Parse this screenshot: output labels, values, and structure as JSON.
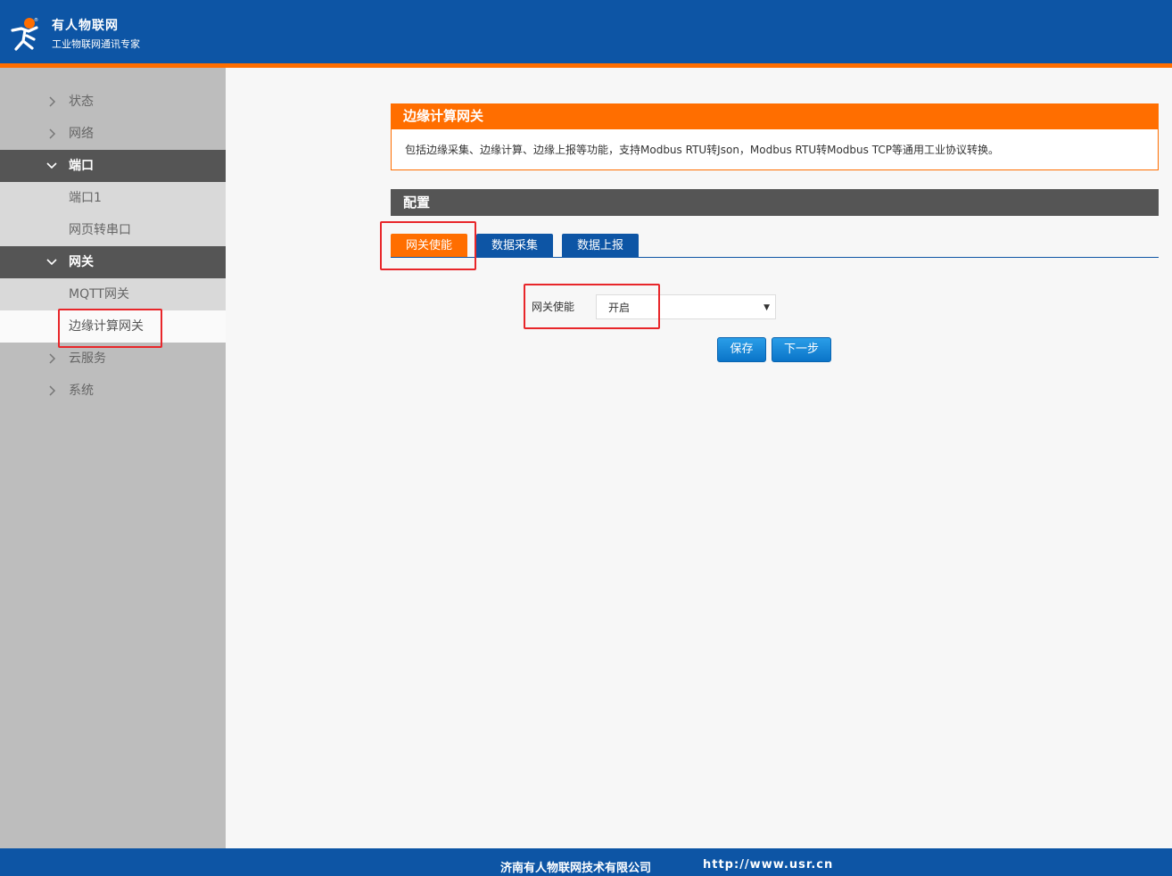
{
  "header": {
    "brand_name": "有人物联网",
    "brand_tagline": "工业物联网通讯专家",
    "logo_icon": "person-logo-icon"
  },
  "colors": {
    "brand_blue": "#0d55a5",
    "accent_orange": "#ff6e00",
    "sidebar_gray": "#bdbdbd",
    "highlight_red": "#e8262a"
  },
  "sidebar": {
    "items": [
      {
        "label": "状态",
        "state": "collapsed"
      },
      {
        "label": "网络",
        "state": "collapsed"
      },
      {
        "label": "端口",
        "state": "expanded"
      },
      {
        "label": "端口1",
        "state": "sub"
      },
      {
        "label": "网页转串口",
        "state": "sub"
      },
      {
        "label": "网关",
        "state": "expanded"
      },
      {
        "label": "MQTT网关",
        "state": "sub"
      },
      {
        "label": "边缘计算网关",
        "state": "active"
      },
      {
        "label": "云服务",
        "state": "collapsed"
      },
      {
        "label": "系统",
        "state": "collapsed"
      }
    ]
  },
  "main": {
    "panel_title": "边缘计算网关",
    "panel_description": "包括边缘采集、边缘计算、边缘上报等功能，支持Modbus RTU转Json，Modbus RTU转Modbus TCP等通用工业协议转换。",
    "config_title": "配置",
    "tabs": [
      {
        "label": "网关使能",
        "active": true
      },
      {
        "label": "数据采集",
        "active": false
      },
      {
        "label": "数据上报",
        "active": false
      }
    ],
    "gateway_enable": {
      "label": "网关使能",
      "value": "开启"
    },
    "buttons": {
      "save": "保存",
      "next": "下一步"
    }
  },
  "footer": {
    "company": "济南有人物联网技术有限公司",
    "url": "http://www.usr.cn"
  }
}
